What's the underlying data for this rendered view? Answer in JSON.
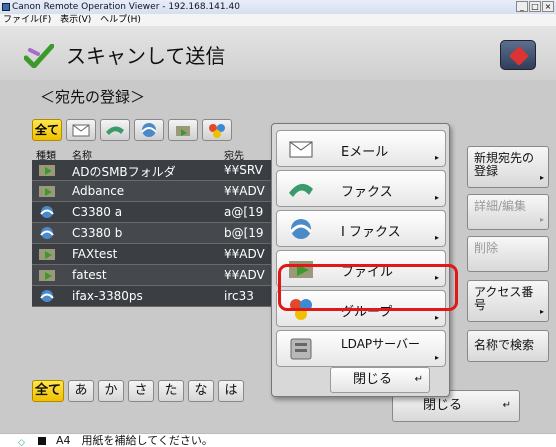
{
  "window": {
    "title": "Canon Remote Operation Viewer - 192.168.141.40",
    "menu": [
      "ファイル(F)",
      "表示(V)",
      "ヘルプ(H)"
    ],
    "buttons": [
      "_",
      "□",
      "×"
    ]
  },
  "header": {
    "title": "スキャンして送信"
  },
  "subtitle": "＜宛先の登録＞",
  "filter": {
    "all_label": "全て"
  },
  "columns": {
    "type": "種類",
    "name": "名称",
    "dest": "宛先"
  },
  "rows": [
    {
      "icon": "file-icon",
      "name": "ADのSMBフォルダ",
      "dest": "¥¥SRV"
    },
    {
      "icon": "file-icon",
      "name": "Adbance",
      "dest": "¥¥ADV"
    },
    {
      "icon": "ifax-icon",
      "name": "C3380 a",
      "dest": "a@[19"
    },
    {
      "icon": "ifax-icon",
      "name": "C3380 b",
      "dest": "b@[19"
    },
    {
      "icon": "file-icon",
      "name": "FAXtest",
      "dest": "¥¥ADV"
    },
    {
      "icon": "file-icon",
      "name": "fatest",
      "dest": "¥¥ADV"
    },
    {
      "icon": "ifax-icon",
      "name": "ifax-3380ps",
      "dest": "irc33"
    }
  ],
  "kana": [
    "全て",
    "あ",
    "か",
    "さ",
    "た",
    "な",
    "は"
  ],
  "side_buttons": [
    {
      "label": "新規宛先の登録",
      "enabled": true
    },
    {
      "label": "詳細/編集",
      "enabled": false
    },
    {
      "label": "削除",
      "enabled": false
    },
    {
      "label": "アクセス番号",
      "enabled": true
    },
    {
      "label": "名称で検索",
      "enabled": true
    }
  ],
  "background_close": "閉じる",
  "popup": {
    "items": [
      {
        "label": "Eメール",
        "icon": "email-icon"
      },
      {
        "label": "ファクス",
        "icon": "fax-icon"
      },
      {
        "label": "I ファクス",
        "icon": "ifax-icon"
      },
      {
        "label": "ファイル",
        "icon": "file-icon",
        "highlighted": true
      },
      {
        "label": "グループ",
        "icon": "group-icon"
      },
      {
        "label": "LDAPサーバー",
        "icon": "ldap-server-icon"
      }
    ],
    "close_label": "閉じる"
  },
  "status": {
    "paper": "A4",
    "message": "用紙を補給してください。"
  },
  "colors": {
    "highlight": "#e01818",
    "selected": "#f0c000",
    "list_bg": "#3b3f44"
  }
}
